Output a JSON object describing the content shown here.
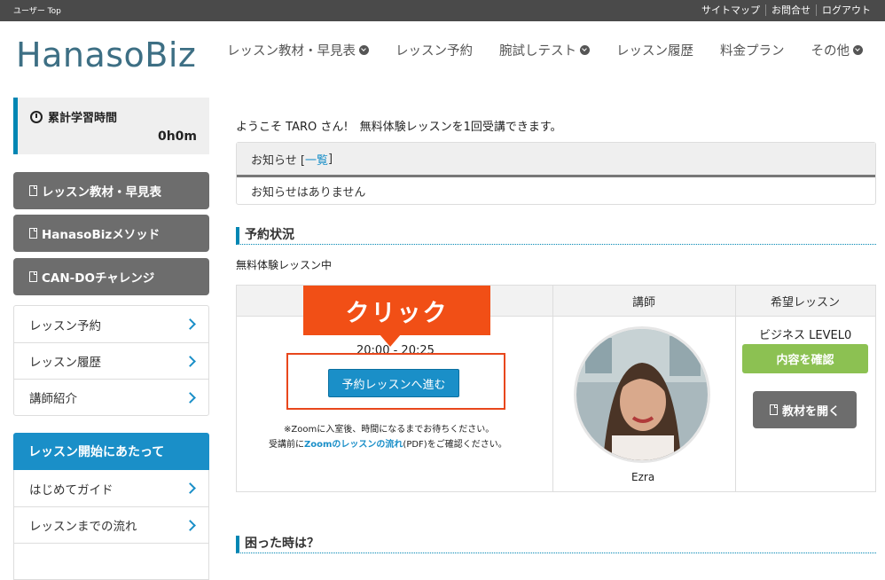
{
  "topbar": {
    "breadcrumb": "ユーザー Top",
    "links": [
      "サイトマップ",
      "お問合せ",
      "ログアウト"
    ]
  },
  "header": {
    "logo": "HanasoBiz",
    "nav": [
      {
        "label": "レッスン教材・早見表",
        "dropdown": true
      },
      {
        "label": "レッスン予約",
        "dropdown": false
      },
      {
        "label": "腕試しテスト",
        "dropdown": true
      },
      {
        "label": "レッスン履歴",
        "dropdown": false
      },
      {
        "label": "料金プラン",
        "dropdown": false
      },
      {
        "label": "その他",
        "dropdown": true
      }
    ]
  },
  "sidebar": {
    "study_title": "累計学習時間",
    "study_value": "0h0m",
    "buttons": [
      "レッスン教材・早見表",
      "HanasoBizメソッド",
      "CAN-DOチャレンジ"
    ],
    "menu": [
      "レッスン予約",
      "レッスン履歴",
      "講師紹介"
    ],
    "guide_header": "レッスン開始にあたって",
    "guide_menu": [
      "はじめてガイド",
      "レッスンまでの流れ"
    ]
  },
  "main": {
    "welcome": "ようこそ TARO さん!　無料体験レッスンを1回受講できます。",
    "news_title": "お知らせ [",
    "news_link": "一覧",
    "news_title_end": "]",
    "news_body": "お知らせはありません",
    "reservation_heading": "予約状況",
    "trial_text": "無料体験レッスン中",
    "table_headers": [
      "",
      "講師",
      "希望レッスン"
    ],
    "time_range": "20:00 - 20:25",
    "reserve_button": "予約レッスンへ進む",
    "note1": "※Zoomに入室後、時間になるまでお待ちください。",
    "note2_pre": "受講前に",
    "note2_link": "Zoomのレッスンの流れ",
    "note2_post": "(PDF)をご確認ください。",
    "teacher_name": "Ezra",
    "lesson_name": "ビジネス LEVEL0",
    "confirm_button": "内容を確認",
    "material_button": "教材を開く",
    "help_heading": "困った時は？"
  },
  "annotation": {
    "callout_text": "クリック",
    "color": "#f14f16"
  },
  "colors": {
    "accent": "#1a8fc8",
    "green": "#8cc152",
    "gray_button": "#6d6d6d",
    "topbar": "#4a4a4a"
  }
}
